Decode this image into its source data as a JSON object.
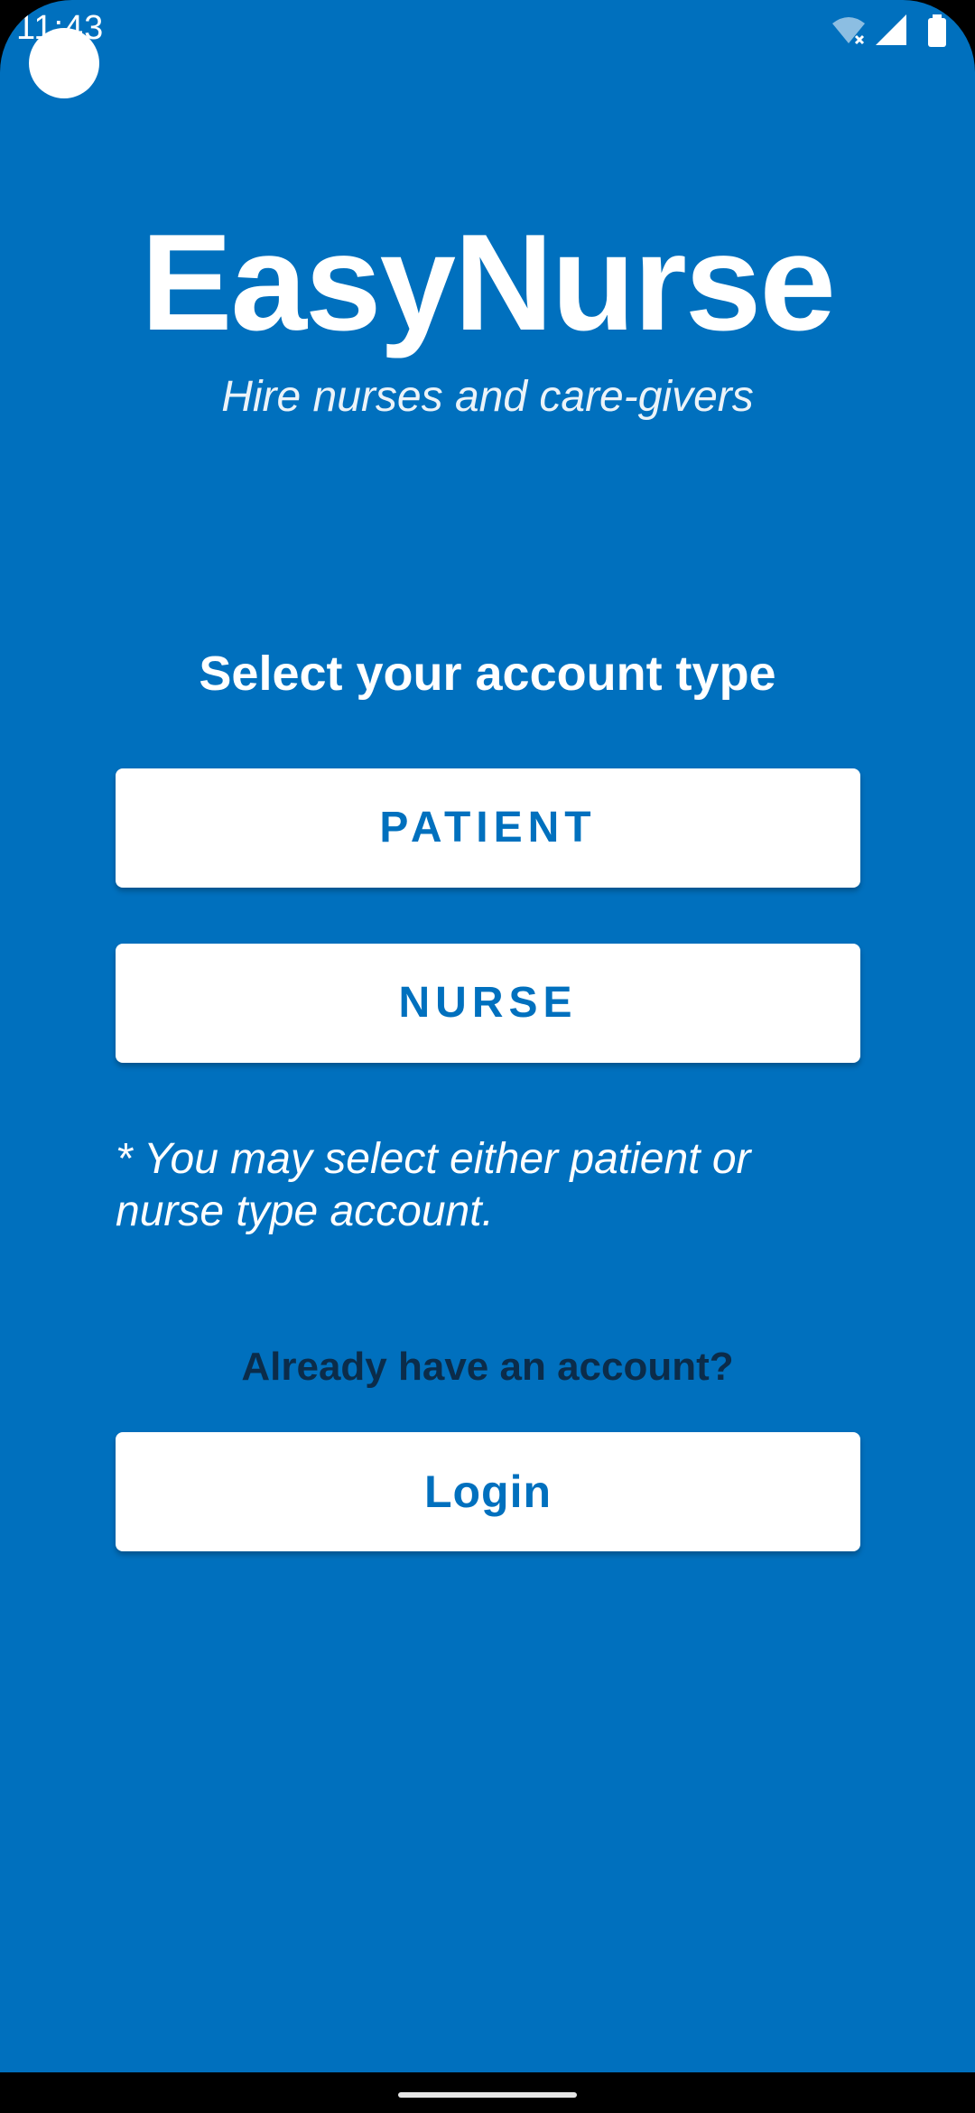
{
  "status_bar": {
    "time": "11:43",
    "icons": [
      "wifi-off-icon",
      "signal-icon",
      "battery-icon"
    ]
  },
  "app": {
    "title": "EasyNurse",
    "subtitle": "Hire nurses and care-givers"
  },
  "account_select": {
    "heading": "Select your account type",
    "patient_label": "PATIENT",
    "nurse_label": "NURSE",
    "note": "* You may select either patient or nurse type account."
  },
  "login_section": {
    "prompt": "Already have an account?",
    "login_label": "Login"
  },
  "colors": {
    "background": "#0070BE",
    "button_bg": "#FFFFFF",
    "button_text": "#0070BE",
    "prompt_text": "#0B2C4A"
  }
}
